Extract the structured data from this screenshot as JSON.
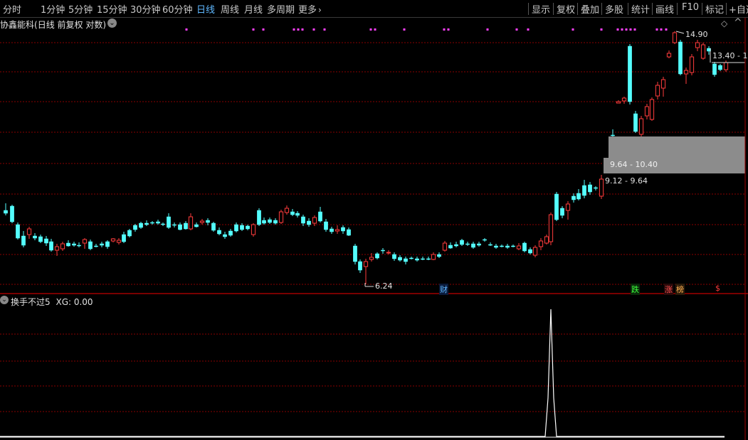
{
  "toolbar": {
    "periods": [
      "分时",
      "1分钟",
      "5分钟",
      "15分钟",
      "30分钟",
      "60分钟",
      "日线",
      "周线",
      "月线",
      "多周期"
    ],
    "active_period": "日线",
    "more_label": "更多",
    "right_buttons": [
      "显示",
      "复权",
      "叠加",
      "多股",
      "统计",
      "画线",
      "F10",
      "标记",
      "+自选"
    ]
  },
  "chart_header": {
    "stock_name": "协鑫能科",
    "mode": "(日线 前复权 对数)"
  },
  "price_labels": {
    "high_label": "14.90",
    "low_label": "6.24",
    "range_label_1": "13.40 - 1",
    "range_label_2": "9.64 - 10.40",
    "range_label_3": "9.12 - 9.64"
  },
  "event_markers": {
    "cai": "财",
    "die": "跌",
    "zhang": "涨",
    "bang": "榜",
    "dollar": "$"
  },
  "indicator": {
    "title": "换手不过5",
    "value_label": "XG: 0.00"
  },
  "colors": {
    "up": "#ff3c3c",
    "down": "#54ffff",
    "grid": "#8a0000",
    "marker": "#ff40ff",
    "active_tab": "#5fb8ff",
    "zone": "#8c8c8c"
  },
  "chart_data": {
    "type": "candlestick",
    "scale": "log",
    "series_high": 14.9,
    "series_low": 6.24,
    "indicator_series": "XG"
  }
}
